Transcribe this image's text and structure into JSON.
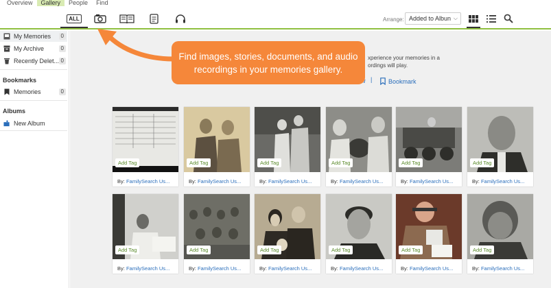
{
  "topnav": {
    "items": [
      "Overview",
      "Gallery",
      "People",
      "Find"
    ],
    "active": "Gallery"
  },
  "toolbar": {
    "filters": [
      {
        "label": "ALL",
        "icon": "all-icon"
      },
      {
        "icon": "camera-icon"
      },
      {
        "icon": "book-icon"
      },
      {
        "icon": "document-icon"
      },
      {
        "icon": "headphones-icon"
      }
    ],
    "arrange_label": "Arrange:",
    "arrange_value": "Added to Albun",
    "views": [
      "grid-view-icon",
      "list-view-icon"
    ],
    "search_icon": "search-icon"
  },
  "sidebar": {
    "items": [
      {
        "label": "My Memories",
        "count": "0",
        "icon": "memories-icon"
      },
      {
        "label": "My Archive",
        "count": "0",
        "icon": "archive-icon"
      },
      {
        "label": "Recently Delet...",
        "count": "0",
        "icon": "trash-icon"
      }
    ],
    "bookmarks_heading": "Bookmarks",
    "bookmarks": [
      {
        "label": "Memories",
        "count": "0",
        "icon": "bookmark-icon"
      }
    ],
    "albums_heading": "Albums",
    "new_album": "New Album"
  },
  "main": {
    "intro_text": "xperience your memories in a\nordings will play.",
    "link_fragment": "w",
    "link_separator": "|",
    "bookmark_link": "Bookmark"
  },
  "callout": {
    "text": "Find images, stories, documents, and audio recordings in your memories gallery.",
    "color": "#f5873a"
  },
  "cards": [
    {
      "tag": "Add Tag",
      "by": "By:",
      "who": "FamilySearch Us..."
    },
    {
      "tag": "Add Tag",
      "by": "By:",
      "who": "FamilySearch Us..."
    },
    {
      "tag": "Add Tag",
      "by": "By:",
      "who": "FamilySearch Us..."
    },
    {
      "tag": "Add Tag",
      "by": "By:",
      "who": "FamilySearch Us..."
    },
    {
      "tag": "Add Tag",
      "by": "By:",
      "who": "FamilySearch Us..."
    },
    {
      "tag": "Add Tag",
      "by": "By:",
      "who": "FamilySearch Us..."
    },
    {
      "tag": "Add Tag",
      "by": "By:",
      "who": "FamilySearch Us..."
    },
    {
      "tag": "Add Tag",
      "by": "By:",
      "who": "FamilySearch Us..."
    },
    {
      "tag": "Add Tag",
      "by": "By:",
      "who": "FamilySearch Us..."
    },
    {
      "tag": "Add Tag",
      "by": "By:",
      "who": "FamilySearch Us..."
    },
    {
      "tag": "Add Tag",
      "by": "By:",
      "who": "FamilySearch Us..."
    },
    {
      "tag": "Add Tag",
      "by": "By:",
      "who": "FamilySearch Us..."
    }
  ]
}
